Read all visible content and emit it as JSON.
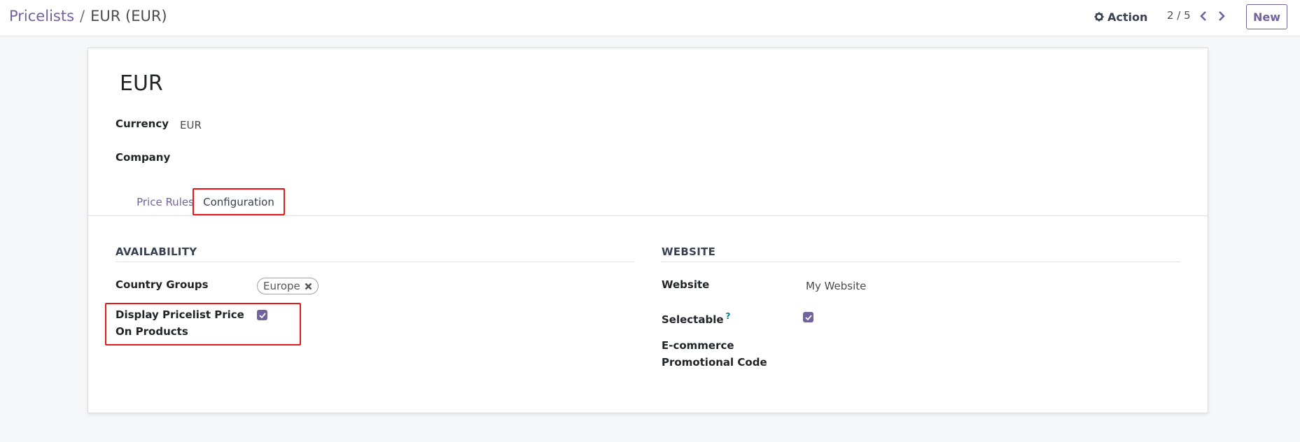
{
  "breadcrumb": {
    "parent": "Pricelists",
    "separator": "/",
    "current": "EUR (EUR)"
  },
  "toolbar": {
    "action_label": "Action",
    "pager_value": "2 / 5",
    "new_label": "New"
  },
  "record": {
    "title": "EUR",
    "fields": {
      "currency_label": "Currency",
      "currency_value": "EUR",
      "company_label": "Company",
      "company_value": ""
    }
  },
  "tabs": [
    {
      "label": "Price Rules",
      "active": false
    },
    {
      "label": "Configuration",
      "active": true
    }
  ],
  "availability": {
    "title": "AVAILABILITY",
    "country_groups_label": "Country Groups",
    "country_group_tags": [
      "Europe"
    ],
    "display_price_label_line1": "Display Pricelist Price",
    "display_price_label_line2": "On Products",
    "display_price_checked": true
  },
  "website": {
    "title": "WEBSITE",
    "website_label": "Website",
    "website_value": "My Website",
    "selectable_label": "Selectable",
    "selectable_help": "?",
    "selectable_checked": true,
    "promo_label_line1": "E-commerce",
    "promo_label_line2": "Promotional Code",
    "promo_value": ""
  },
  "colors": {
    "accent": "#71639e",
    "highlight": "#e31a1a",
    "help": "#017e84"
  },
  "icons": {
    "action": "gear-icon",
    "prev": "chevron-left-icon",
    "next": "chevron-right-icon",
    "tag_remove": "close-icon",
    "checkbox": "checkmark-icon"
  }
}
